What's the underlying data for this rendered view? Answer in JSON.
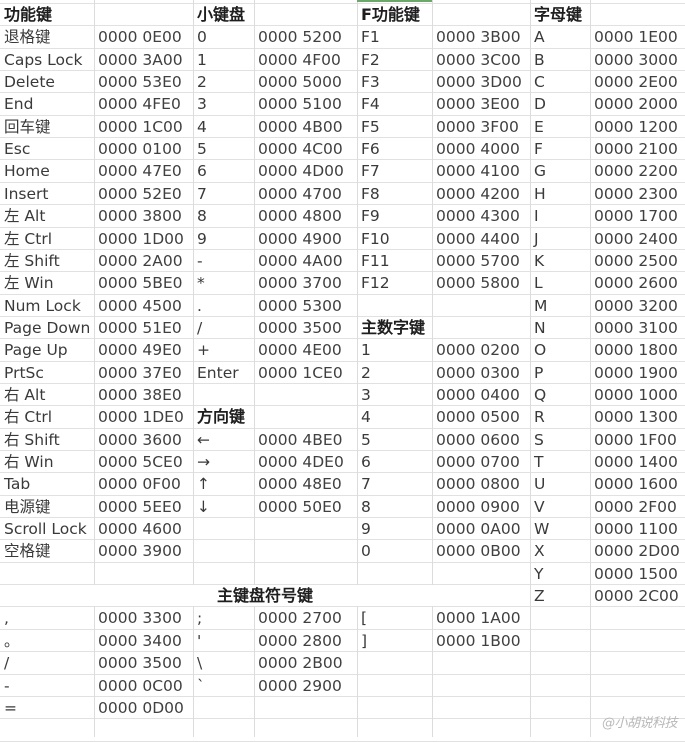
{
  "sections": {
    "function_keys": {
      "title": "功能键",
      "rows": [
        {
          "key": "退格键",
          "code": "0000 0E00"
        },
        {
          "key": "Caps Lock",
          "code": "0000 3A00"
        },
        {
          "key": "Delete",
          "code": "0000 53E0"
        },
        {
          "key": "End",
          "code": "0000 4FE0"
        },
        {
          "key": "回车键",
          "code": "0000 1C00"
        },
        {
          "key": "Esc",
          "code": "0000 0100"
        },
        {
          "key": "Home",
          "code": "0000 47E0"
        },
        {
          "key": "Insert",
          "code": "0000 52E0"
        },
        {
          "key": "左 Alt",
          "code": "0000 3800"
        },
        {
          "key": "左 Ctrl",
          "code": "0000 1D00"
        },
        {
          "key": "左 Shift",
          "code": "0000 2A00"
        },
        {
          "key": "左 Win",
          "code": "0000 5BE0"
        },
        {
          "key": "Num Lock",
          "code": "0000 4500"
        },
        {
          "key": "Page Down",
          "code": "0000 51E0"
        },
        {
          "key": "Page Up",
          "code": "0000 49E0"
        },
        {
          "key": "PrtSc",
          "code": "0000 37E0"
        },
        {
          "key": "右 Alt",
          "code": "0000 38E0"
        },
        {
          "key": "右 Ctrl",
          "code": "0000 1DE0"
        },
        {
          "key": "右 Shift",
          "code": "0000 3600"
        },
        {
          "key": "右 Win",
          "code": "0000 5CE0"
        },
        {
          "key": "Tab",
          "code": "0000 0F00"
        },
        {
          "key": "电源键",
          "code": "0000 5EE0"
        },
        {
          "key": "Scroll Lock",
          "code": "0000 4600"
        },
        {
          "key": "空格键",
          "code": "0000 3900"
        }
      ]
    },
    "numpad": {
      "title": "小键盘",
      "rows": [
        {
          "key": "0",
          "code": "0000 5200"
        },
        {
          "key": "1",
          "code": "0000 4F00"
        },
        {
          "key": "2",
          "code": "0000 5000"
        },
        {
          "key": "3",
          "code": "0000 5100"
        },
        {
          "key": "4",
          "code": "0000 4B00"
        },
        {
          "key": "5",
          "code": "0000 4C00"
        },
        {
          "key": "6",
          "code": "0000 4D00"
        },
        {
          "key": "7",
          "code": "0000 4700"
        },
        {
          "key": "8",
          "code": "0000 4800"
        },
        {
          "key": "9",
          "code": "0000 4900"
        },
        {
          "key": "-",
          "code": "0000 4A00"
        },
        {
          "key": "*",
          "code": "0000 3700"
        },
        {
          "key": ".",
          "code": "0000 5300"
        },
        {
          "key": "/",
          "code": "0000 3500"
        },
        {
          "key": "+",
          "code": "0000 4E00"
        },
        {
          "key": "Enter",
          "code": "0000 1CE0"
        }
      ]
    },
    "arrow_keys": {
      "title": "方向键",
      "rows": [
        {
          "key": "←",
          "code": "0000 4BE0"
        },
        {
          "key": "→",
          "code": "0000 4DE0"
        },
        {
          "key": "↑",
          "code": "0000 48E0"
        },
        {
          "key": "↓",
          "code": "0000 50E0"
        }
      ]
    },
    "f_keys": {
      "title": "F功能键",
      "rows": [
        {
          "key": "F1",
          "code": "0000 3B00"
        },
        {
          "key": "F2",
          "code": "0000 3C00"
        },
        {
          "key": "F3",
          "code": "0000 3D00"
        },
        {
          "key": "F4",
          "code": "0000 3E00"
        },
        {
          "key": "F5",
          "code": "0000 3F00"
        },
        {
          "key": "F6",
          "code": "0000 4000"
        },
        {
          "key": "F7",
          "code": "0000 4100"
        },
        {
          "key": "F8",
          "code": "0000 4200"
        },
        {
          "key": "F9",
          "code": "0000 4300"
        },
        {
          "key": "F10",
          "code": "0000 4400"
        },
        {
          "key": "F11",
          "code": "0000 5700"
        },
        {
          "key": "F12",
          "code": "0000 5800"
        }
      ]
    },
    "main_number_keys": {
      "title": "主数字键",
      "rows": [
        {
          "key": "1",
          "code": "0000 0200"
        },
        {
          "key": "2",
          "code": "0000 0300"
        },
        {
          "key": "3",
          "code": "0000 0400"
        },
        {
          "key": "4",
          "code": "0000 0500"
        },
        {
          "key": "5",
          "code": "0000 0600"
        },
        {
          "key": "6",
          "code": "0000 0700"
        },
        {
          "key": "7",
          "code": "0000 0800"
        },
        {
          "key": "8",
          "code": "0000 0900"
        },
        {
          "key": "9",
          "code": "0000 0A00"
        },
        {
          "key": "0",
          "code": "0000 0B00"
        }
      ]
    },
    "letter_keys": {
      "title": "字母键",
      "rows": [
        {
          "key": "A",
          "code": "0000 1E00"
        },
        {
          "key": "B",
          "code": "0000 3000"
        },
        {
          "key": "C",
          "code": "0000 2E00"
        },
        {
          "key": "D",
          "code": "0000 2000"
        },
        {
          "key": "E",
          "code": "0000 1200"
        },
        {
          "key": "F",
          "code": "0000 2100"
        },
        {
          "key": "G",
          "code": "0000 2200"
        },
        {
          "key": "H",
          "code": "0000 2300"
        },
        {
          "key": "I",
          "code": "0000 1700"
        },
        {
          "key": "J",
          "code": "0000 2400"
        },
        {
          "key": "K",
          "code": "0000 2500"
        },
        {
          "key": "L",
          "code": "0000 2600"
        },
        {
          "key": "M",
          "code": "0000 3200"
        },
        {
          "key": "N",
          "code": "0000 3100"
        },
        {
          "key": "O",
          "code": "0000 1800"
        },
        {
          "key": "P",
          "code": "0000 1900"
        },
        {
          "key": "Q",
          "code": "0000 1000"
        },
        {
          "key": "R",
          "code": "0000 1300"
        },
        {
          "key": "S",
          "code": "0000 1F00"
        },
        {
          "key": "T",
          "code": "0000 1400"
        },
        {
          "key": "U",
          "code": "0000 1600"
        },
        {
          "key": "V",
          "code": "0000 2F00"
        },
        {
          "key": "W",
          "code": "0000 1100"
        },
        {
          "key": "X",
          "code": "0000 2D00"
        },
        {
          "key": "Y",
          "code": "0000 1500"
        },
        {
          "key": "Z",
          "code": "0000 2C00"
        }
      ]
    },
    "symbol_keys": {
      "title": "主键盘符号键",
      "group1": [
        {
          "key": ",",
          "code": "0000 3300"
        },
        {
          "key": "。",
          "code": "0000 3400"
        },
        {
          "key": "/",
          "code": "0000 3500"
        },
        {
          "key": "-",
          "code": "0000 0C00"
        },
        {
          "key": "=",
          "code": "0000 0D00"
        }
      ],
      "group2": [
        {
          "key": ";",
          "code": "0000 2700"
        },
        {
          "key": "'",
          "code": "0000 2800"
        },
        {
          "key": "\\",
          "code": "0000 2B00"
        },
        {
          "key": "`",
          "code": "0000 2900"
        }
      ],
      "group3": [
        {
          "key": "[",
          "code": "0000 1A00"
        },
        {
          "key": "]",
          "code": "0000 1B00"
        }
      ]
    }
  },
  "watermark": "@小胡说科技"
}
